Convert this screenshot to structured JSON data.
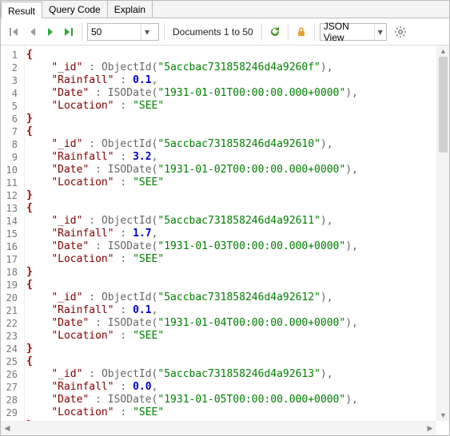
{
  "tabs": {
    "result": "Result",
    "query_code": "Query Code",
    "explain": "Explain"
  },
  "toolbar": {
    "page_size": "50",
    "doc_range": "Documents 1 to 50",
    "view_mode": "JSON View"
  },
  "records": [
    {
      "_id": "5accbac731858246d4a9260f",
      "Rainfall": 0.1,
      "Date": "1931-01-01T00:00:00.000+0000",
      "Location": "SEE"
    },
    {
      "_id": "5accbac731858246d4a92610",
      "Rainfall": 3.2,
      "Date": "1931-01-02T00:00:00.000+0000",
      "Location": "SEE"
    },
    {
      "_id": "5accbac731858246d4a92611",
      "Rainfall": 1.7,
      "Date": "1931-01-03T00:00:00.000+0000",
      "Location": "SEE"
    },
    {
      "_id": "5accbac731858246d4a92612",
      "Rainfall": 0.1,
      "Date": "1931-01-04T00:00:00.000+0000",
      "Location": "SEE"
    },
    {
      "_id": "5accbac731858246d4a92613",
      "Rainfall": 0.0,
      "Date": "1931-01-05T00:00:00.000+0000",
      "Location": "SEE"
    }
  ],
  "field_labels": {
    "_id": "\"_id\"",
    "rainfall": "\"Rainfall\"",
    "date": "\"Date\"",
    "location": "\"Location\""
  },
  "wrap_labels": {
    "objectid": "ObjectId",
    "isodate": "ISODate"
  },
  "colors": {
    "key": "#800000",
    "string": "#008000",
    "number": "#0000cc",
    "brace": "#a00000"
  }
}
